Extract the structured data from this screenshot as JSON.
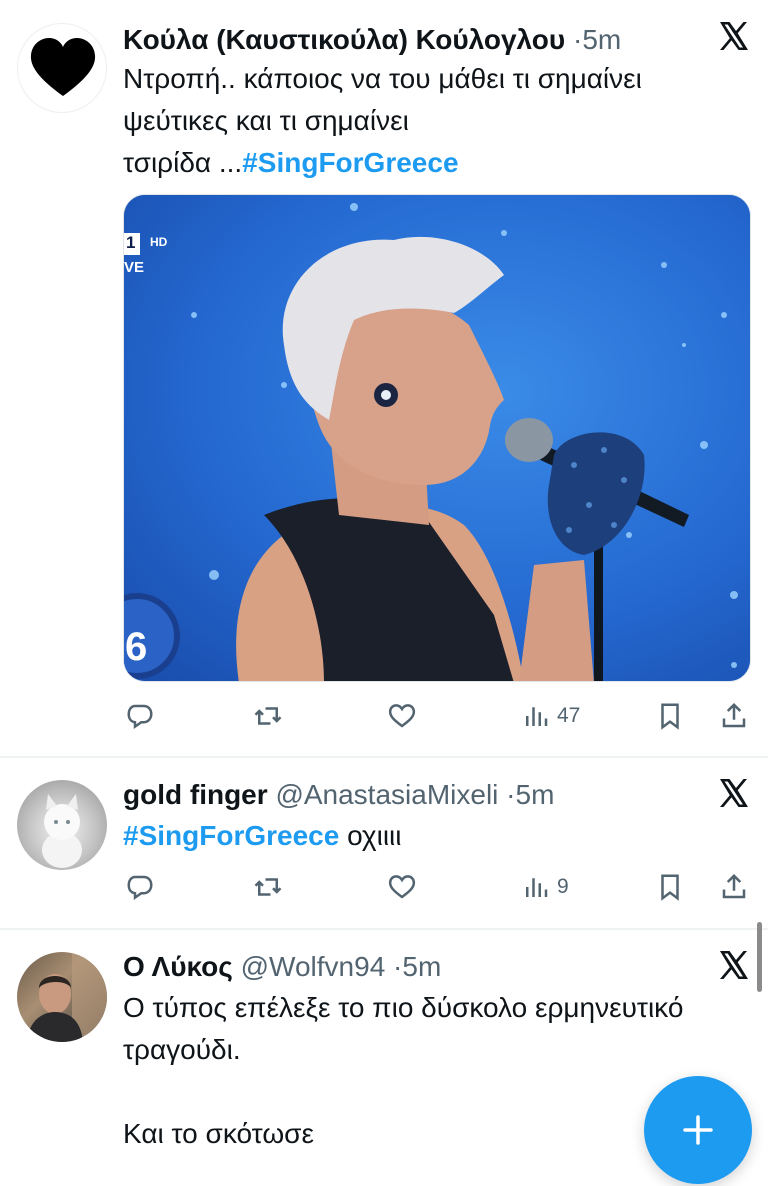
{
  "colors": {
    "accent": "#1d9bf0",
    "muted": "#536471",
    "text": "#0f1419"
  },
  "tweets": [
    {
      "name": "Κούλα (Καυστικούλα) Κούλογλου",
      "dot": "·",
      "time": "5m",
      "text_lines": [
        "Ντροπή.. κάποιος να του μάθει τι σημαίνει",
        "ψεύτικες και τι σημαίνει"
      ],
      "text_tail": "τσιρίδα ...",
      "hashtag": "#SingForGreece",
      "media": {
        "channel": "1",
        "hd": "HD",
        "live": "VE",
        "badge_number": "6"
      },
      "views": "47",
      "avatar_icon": "heart-icon"
    },
    {
      "name": "gold finger",
      "handle": "@AnastasiaMixeli",
      "dot": "·",
      "time": "5m",
      "hashtag": "#SingForGreece",
      "text": " οχιιιι",
      "views": "9",
      "avatar_icon": "white-cat-avatar"
    },
    {
      "name": "Ο Λύκος",
      "handle": "@Wolfvn94",
      "dot": "·",
      "time": "5m",
      "text_lines": [
        "Ο τύπος επέλεξε το πιο δύσκολο ερμηνευτικό",
        "τραγούδι."
      ],
      "text_last": "Και το σκότωσε",
      "avatar_icon": "man-avatar"
    }
  ],
  "icons": [
    "reply-icon",
    "retweet-icon",
    "like-icon",
    "views-icon",
    "bookmark-icon",
    "share-icon",
    "x-logo-icon",
    "compose-plus-icon"
  ]
}
